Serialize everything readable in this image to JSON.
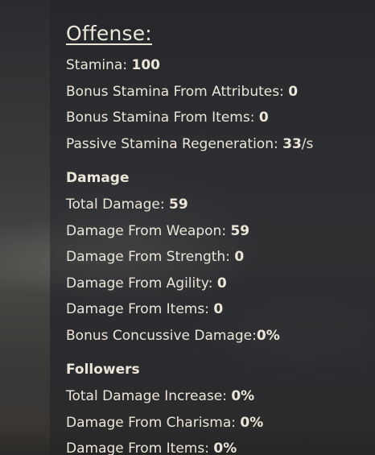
{
  "offense": {
    "title": "Offense:",
    "stats": [
      {
        "label": "Stamina: ",
        "value": "100",
        "suffix": ""
      },
      {
        "label": "Bonus Stamina From Attributes: ",
        "value": "0",
        "suffix": ""
      },
      {
        "label": "Bonus Stamina From Items: ",
        "value": "0",
        "suffix": ""
      },
      {
        "label": "Passive Stamina Regeneration: ",
        "value": "33",
        "suffix": "/s"
      }
    ]
  },
  "damage": {
    "heading": "Damage",
    "stats": [
      {
        "label": "Total Damage: ",
        "value": "59"
      },
      {
        "label": "Damage From Weapon: ",
        "value": "59"
      },
      {
        "label": "Damage From Strength: ",
        "value": "0"
      },
      {
        "label": "Damage From Agility: ",
        "value": "0"
      },
      {
        "label": "Damage From Items: ",
        "value": "0"
      },
      {
        "label": "Bonus Concussive Damage:",
        "value": "0%"
      }
    ]
  },
  "followers": {
    "heading": "Followers",
    "stats": [
      {
        "label": "Total Damage Increase: ",
        "value": "0%"
      },
      {
        "label": "Damage From Charisma: ",
        "value": "0%"
      },
      {
        "label": "Damage From Items: ",
        "value": "0%"
      }
    ]
  }
}
